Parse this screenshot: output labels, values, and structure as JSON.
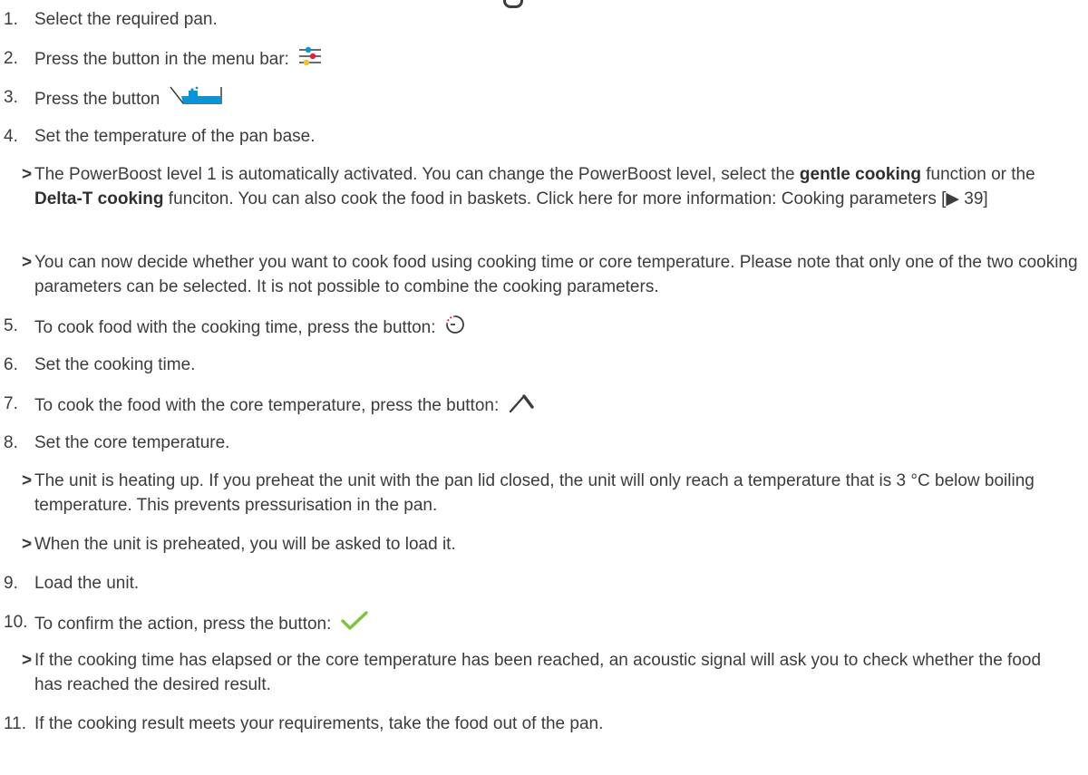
{
  "steps": [
    {
      "id": "s1",
      "type": "step",
      "num": "1.",
      "text": "Select the required pan."
    },
    {
      "id": "s2",
      "type": "step",
      "num": "2.",
      "text": "Press the button in the menu bar:",
      "icon": "settings-sliders-icon"
    },
    {
      "id": "s3",
      "type": "step",
      "num": "3.",
      "text": "Press the button",
      "icon": "pan-icon"
    },
    {
      "id": "s4",
      "type": "step",
      "num": "4.",
      "text": "Set the temperature of the pan base."
    },
    {
      "id": "r1",
      "type": "result",
      "num": ">",
      "parts": {
        "a": "The PowerBoost level 1 is automatically activated. You can change the PowerBoost level, select the ",
        "b": "gentle cooking",
        "c": " function or the ",
        "d": "Delta-T cooking",
        "e": " funciton. You can also cook the food in baskets. Click here for more information: ",
        "link": "Cooking parameters [▶ 39]"
      }
    },
    {
      "id": "r2",
      "type": "result",
      "num": ">",
      "text": "You can now decide whether you want to cook food using cooking time or core temperature. Please note that only one of the two cooking parameters can be selected. It is not possible to combine the cooking parameters."
    },
    {
      "id": "s5",
      "type": "step",
      "num": "5.",
      "text": "To cook food with the cooking time, press the button:",
      "icon": "timer-icon"
    },
    {
      "id": "s6",
      "type": "step",
      "num": "6.",
      "text": "Set the cooking time."
    },
    {
      "id": "s7",
      "type": "step",
      "num": "7.",
      "text": "To cook the food with the core temperature, press the button:",
      "icon": "core-probe-icon"
    },
    {
      "id": "s8",
      "type": "step",
      "num": "8.",
      "text": "Set the core temperature."
    },
    {
      "id": "r3",
      "type": "result",
      "num": ">",
      "text": "The unit is heating up. If you preheat the unit with the pan lid closed, the unit will only reach a temperature that is 3 °C below boiling temperature. This prevents pressurisation in the pan."
    },
    {
      "id": "r4",
      "type": "result",
      "num": ">",
      "text": "When the unit is preheated, you will be asked to load it."
    },
    {
      "id": "s9",
      "type": "step",
      "num": "9.",
      "text": "Load the unit."
    },
    {
      "id": "s10",
      "type": "step",
      "num": "10.",
      "text": "To confirm the action, press the button:",
      "icon": "checkmark-icon"
    },
    {
      "id": "r5",
      "type": "result",
      "num": ">",
      "text": "If the cooking time has elapsed or the core temperature has been reached, an acoustic signal will ask you to check whether the food has reached the desired result."
    },
    {
      "id": "s11",
      "type": "step",
      "num": "11.",
      "text": "If the cooking result meets your requirements, take the food out of the pan."
    }
  ],
  "colors": {
    "text": "#3c3c3c",
    "accent_blue": "#0a94d6",
    "accent_red": "#e0223a",
    "accent_yellow": "#f2c12e",
    "check_green": "#7dc243"
  }
}
